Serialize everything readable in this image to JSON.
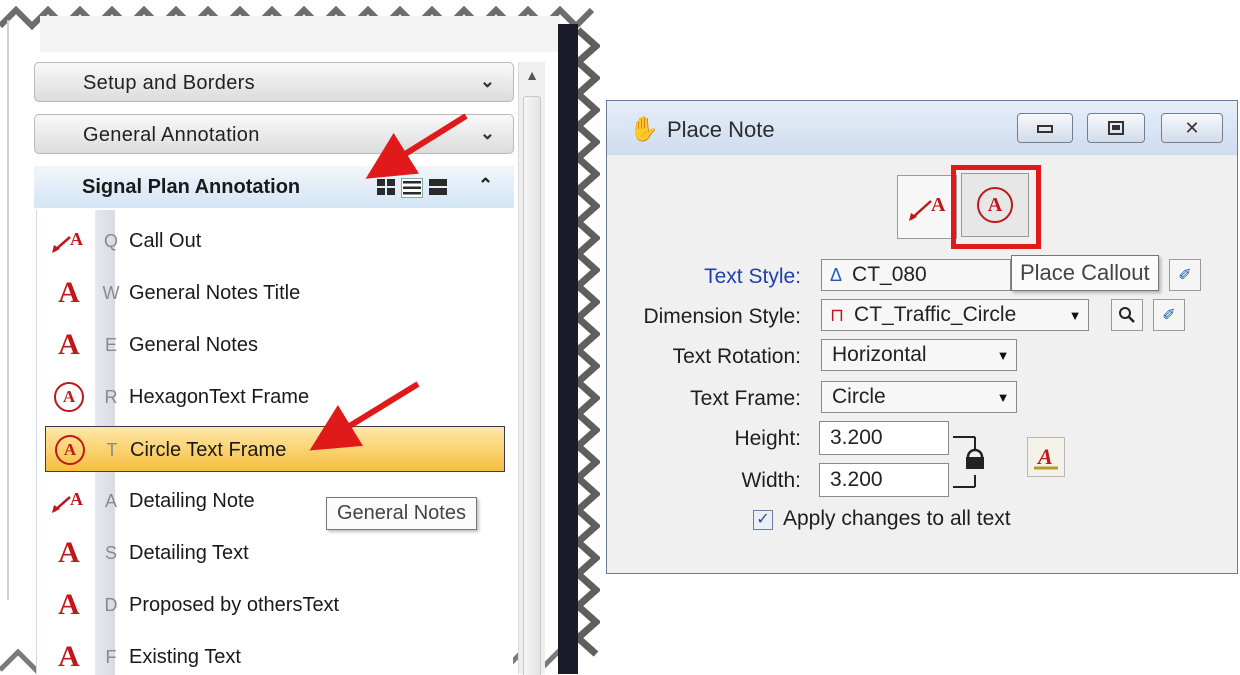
{
  "left_panel": {
    "sections": [
      {
        "label": "Setup and Borders"
      },
      {
        "label": "General Annotation"
      }
    ],
    "active_section": {
      "label": "Signal Plan Annotation"
    },
    "tools": [
      {
        "key": "Q",
        "label": "Call Out",
        "icon": "callout-icon"
      },
      {
        "key": "W",
        "label": "General Notes Title",
        "icon": "text-a-icon"
      },
      {
        "key": "E",
        "label": "General Notes",
        "icon": "text-a-icon"
      },
      {
        "key": "R",
        "label": "HexagonText Frame",
        "icon": "circle-a-icon"
      },
      {
        "key": "T",
        "label": "Circle Text Frame",
        "icon": "circle-a-icon",
        "selected": true
      },
      {
        "key": "A",
        "label": "Detailing Note",
        "icon": "callout-icon"
      },
      {
        "key": "S",
        "label": "Detailing Text",
        "icon": "text-a-icon"
      },
      {
        "key": "D",
        "label": "Proposed by othersText",
        "icon": "text-a-icon"
      },
      {
        "key": "F",
        "label": "Existing Text",
        "icon": "text-a-icon"
      }
    ],
    "tooltip": "General Notes"
  },
  "dialog": {
    "title": "Place Note",
    "tooltip": "Place Callout",
    "fields": {
      "text_style": {
        "label": "Text Style:",
        "value": "CT_080"
      },
      "dimension_style": {
        "label": "Dimension Style:",
        "value": "CT_Traffic_Circle"
      },
      "text_rotation": {
        "label": "Text Rotation:",
        "value": "Horizontal"
      },
      "text_frame": {
        "label": "Text Frame:",
        "value": "Circle"
      },
      "height": {
        "label": "Height:",
        "value": "3.200"
      },
      "width": {
        "label": "Width:",
        "value": "3.200"
      }
    },
    "apply_changes": {
      "label": "Apply changes to all text",
      "checked": true
    }
  },
  "colors": {
    "arrow_red": "#e01a1a",
    "icon_red": "#c0171a",
    "selection_gold": "#f6bf3e",
    "link_blue": "#1f3fb0"
  }
}
